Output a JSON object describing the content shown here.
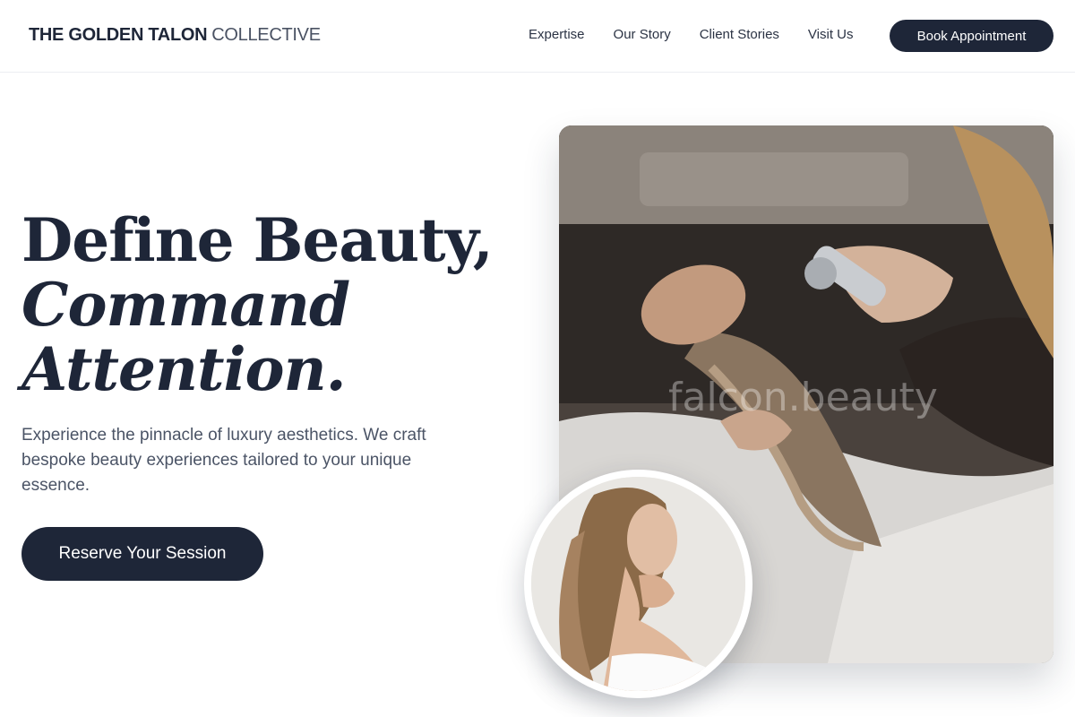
{
  "header": {
    "logo_strong": "THE GOLDEN TALON",
    "logo_light": "COLLECTIVE",
    "nav": [
      "Expertise",
      "Our Story",
      "Client Stories",
      "Visit Us"
    ],
    "cta": "Book Appointment"
  },
  "hero": {
    "headline_line1": "Define Beauty,",
    "headline_line2": "Command",
    "headline_line3": "Attention.",
    "lead": "Experience the pinnacle of luxury aesthetics. We craft bespoke beauty experiences tailored to your unique essence.",
    "cta": "Reserve Your Session"
  },
  "media": {
    "main_photo": "salon-hair-wash-photo",
    "watermark": "falcon.beauty",
    "portrait": "woman-portrait-photo"
  },
  "colors": {
    "navy": "#1e2638",
    "text_muted": "#4b5466",
    "background": "#ffffff"
  }
}
